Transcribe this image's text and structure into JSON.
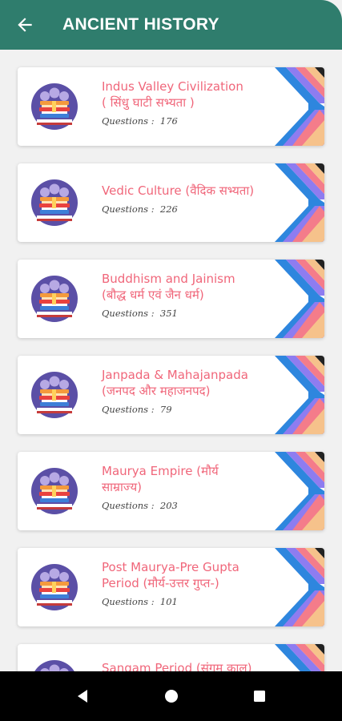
{
  "app_bar": {
    "title": "ANCIENT HISTORY",
    "color": "#2f7d6d",
    "back_icon": "arrow-left-icon"
  },
  "topics": [
    {
      "line1": "Indus Valley Civilization",
      "line2": "( सिंधु घाटी सभ्यता )",
      "questions_label": "Questions :",
      "count": "176"
    },
    {
      "line1": "Vedic Culture (वैदिक सभ्यता)",
      "line2": "",
      "questions_label": "Questions :",
      "count": "226"
    },
    {
      "line1": "Buddhism and Jainism",
      "line2": "(बौद्ध धर्म एवं जैन धर्म)",
      "questions_label": "Questions :",
      "count": "351"
    },
    {
      "line1": "Janpada & Mahajanpada",
      "line2": "(जनपद और महाजनपद)",
      "questions_label": "Questions :",
      "count": "79"
    },
    {
      "line1": "Maurya Empire (मौर्य",
      "line2": "साम्राज्य)",
      "questions_label": "Questions :",
      "count": "203"
    },
    {
      "line1": "Post Maurya-Pre Gupta",
      "line2": "Period (मौर्य-उत्तर गुप्त-)",
      "questions_label": "Questions :",
      "count": "101"
    },
    {
      "line1": "Sangam Period (संगम काल)",
      "line2": "",
      "questions_label": "",
      "count": ""
    }
  ],
  "colors": {
    "accent_text": "#f0667a",
    "stripes": [
      "#2e86de",
      "#8e7cf0",
      "#f47c8a",
      "#f6c28b",
      "#222222"
    ]
  },
  "nav": {
    "back": "triangle-back-icon",
    "home": "circle-home-icon",
    "recents": "square-recents-icon"
  }
}
